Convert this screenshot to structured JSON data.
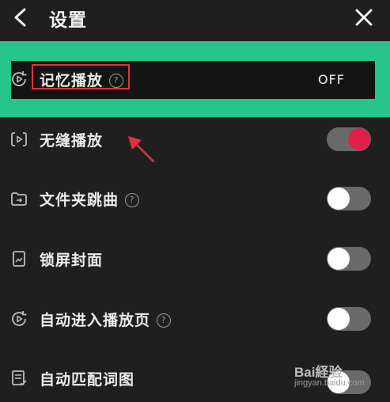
{
  "header": {
    "title": "设置",
    "back_icon": "chevron-left-icon",
    "close_icon": "close-icon"
  },
  "settings": [
    {
      "label": "记忆播放",
      "has_help": true,
      "control": "text",
      "value": "OFF",
      "icon": "playback-resume-icon"
    },
    {
      "label": "无缝播放",
      "has_help": false,
      "control": "toggle",
      "on": true,
      "icon": "seamless-play-icon"
    },
    {
      "label": "文件夹跳曲",
      "has_help": true,
      "control": "toggle",
      "on": false,
      "icon": "folder-skip-icon"
    },
    {
      "label": "锁屏封面",
      "has_help": false,
      "control": "toggle",
      "on": false,
      "icon": "lockscreen-cover-icon"
    },
    {
      "label": "自动进入播放页",
      "has_help": true,
      "control": "toggle",
      "on": false,
      "icon": "auto-enter-player-icon"
    },
    {
      "label": "自动匹配词图",
      "has_help": false,
      "control": "toggle",
      "on": false,
      "icon": "auto-match-lyrics-icon"
    }
  ],
  "help_symbol": "?",
  "colors": {
    "background": "#1f1f1f",
    "highlight": "#26c48a",
    "toggle_on": "#e0204a",
    "annotation_red": "#e03340"
  },
  "watermark": {
    "text": "Bai経验",
    "sub": "jingyan.baidu.com"
  }
}
